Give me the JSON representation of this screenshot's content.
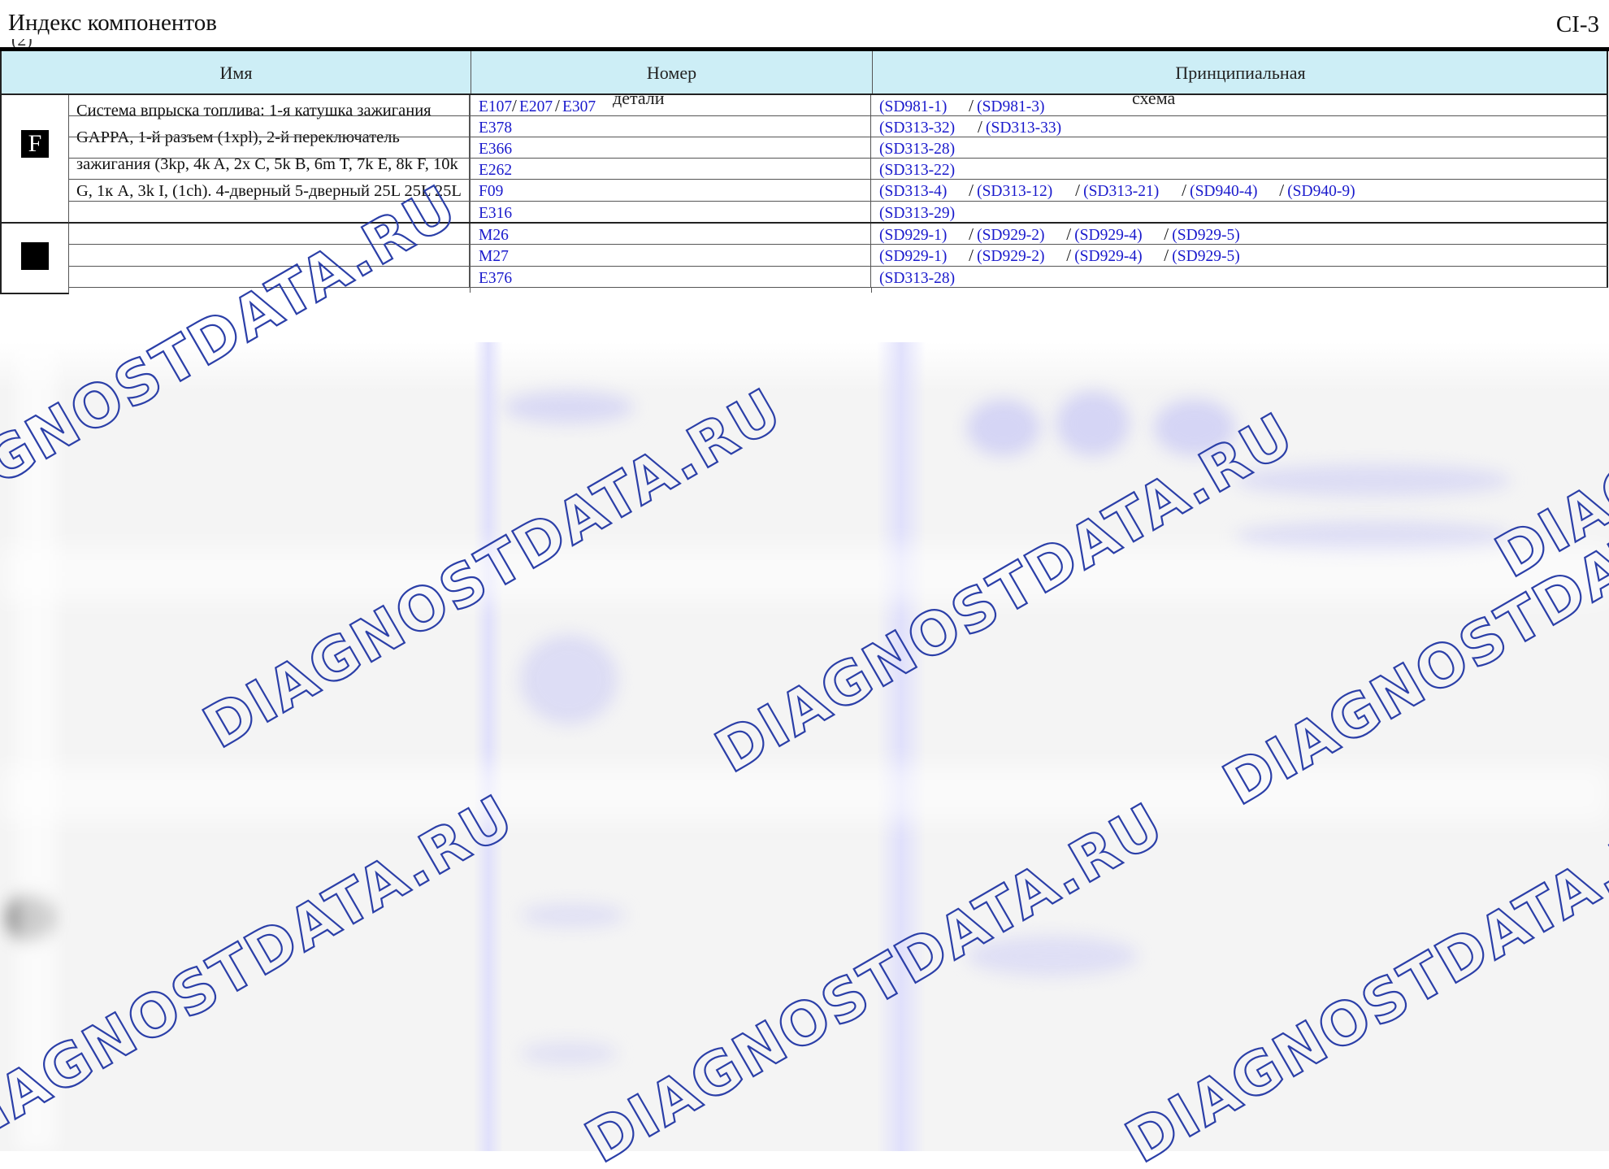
{
  "header": {
    "title": "Индекс компонентов",
    "title_overflow": "(2)",
    "code": "CI-3"
  },
  "table": {
    "columns": [
      {
        "label": "Имя"
      },
      {
        "label": "Номер",
        "overflow": "детали"
      },
      {
        "label": "Принципиальная",
        "overflow": "схема"
      }
    ],
    "groups": [
      {
        "letter": "F",
        "name": "Система впрыска топлива: 1-я катушка зажигания GAPPA, 1-й разъем (1xpl), 2-й переключатель зажигания (3kp, 4k A, 2x C, 5k B, 6m T, 7k E, 8k F, 10k G, 1к A, 3k I, (1ch). 4-дверный 5-дверный 25L 25L 25L",
        "rows": [
          {
            "parts": [
              "E107",
              "E207",
              "E307"
            ],
            "schemes": [
              "(SD981-1)",
              "(SD981-3)"
            ]
          },
          {
            "parts": [
              "E378"
            ],
            "schemes": [
              "(SD313-32)",
              "(SD313-33)"
            ]
          },
          {
            "parts": [
              "E366"
            ],
            "schemes": [
              "(SD313-28)"
            ]
          },
          {
            "parts": [
              "E262"
            ],
            "schemes": [
              "(SD313-22)"
            ]
          },
          {
            "parts": [
              "F09"
            ],
            "schemes": [
              "(SD313-4)",
              "(SD313-12)",
              "(SD313-21)",
              "(SD940-4)",
              "(SD940-9)"
            ]
          },
          {
            "parts": [
              "E316"
            ],
            "schemes": [
              "(SD313-29)"
            ]
          }
        ]
      },
      {
        "letter": "",
        "name": "",
        "rows": [
          {
            "parts": [
              "M26"
            ],
            "schemes": [
              "(SD929-1)",
              "(SD929-2)",
              "(SD929-4)",
              "(SD929-5)"
            ]
          },
          {
            "parts": [
              "M27"
            ],
            "schemes": [
              "(SD929-1)",
              "(SD929-2)",
              "(SD929-4)",
              "(SD929-5)"
            ]
          },
          {
            "parts": [
              "E376"
            ],
            "schemes": [
              "(SD313-28)"
            ]
          }
        ]
      }
    ]
  },
  "watermark": {
    "text": "DIAGNOSTDATA.RU",
    "color": "#2b3fa8"
  }
}
